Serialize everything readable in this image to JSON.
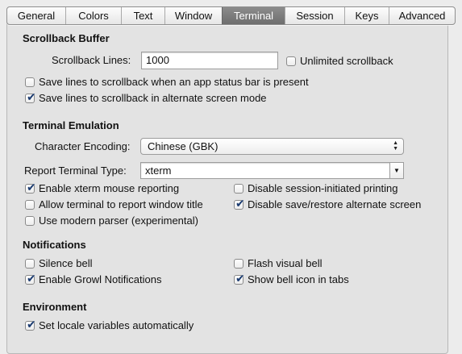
{
  "tabs": [
    {
      "label": "General"
    },
    {
      "label": "Colors"
    },
    {
      "label": "Text"
    },
    {
      "label": "Window"
    },
    {
      "label": "Terminal",
      "active": true
    },
    {
      "label": "Session"
    },
    {
      "label": "Keys"
    },
    {
      "label": "Advanced"
    }
  ],
  "scrollback": {
    "heading": "Scrollback Buffer",
    "lines_label": "Scrollback Lines:",
    "lines_value": "1000",
    "unlimited_label": "Unlimited scrollback",
    "unlimited_checked": false,
    "status_bar_label": "Save lines to scrollback when an app status bar is present",
    "status_bar_checked": false,
    "alt_screen_label": "Save lines to scrollback in alternate screen mode",
    "alt_screen_checked": true
  },
  "emulation": {
    "heading": "Terminal Emulation",
    "encoding_label": "Character Encoding:",
    "encoding_value": "Chinese (GBK)",
    "report_type_label": "Report Terminal Type:",
    "report_type_value": "xterm",
    "xterm_mouse_label": "Enable xterm mouse reporting",
    "xterm_mouse_checked": true,
    "disable_printing_label": "Disable session-initiated printing",
    "disable_printing_checked": false,
    "window_title_label": "Allow terminal to report window title",
    "window_title_checked": false,
    "disable_save_restore_label": "Disable save/restore alternate screen",
    "disable_save_restore_checked": true,
    "modern_parser_label": "Use modern parser (experimental)",
    "modern_parser_checked": false
  },
  "notifications": {
    "heading": "Notifications",
    "silence_bell_label": "Silence bell",
    "silence_bell_checked": false,
    "flash_bell_label": "Flash visual bell",
    "flash_bell_checked": false,
    "growl_label": "Enable Growl Notifications",
    "growl_checked": true,
    "bell_icon_label": "Show bell icon in tabs",
    "bell_icon_checked": true
  },
  "environment": {
    "heading": "Environment",
    "locale_label": "Set locale variables automatically",
    "locale_checked": true
  }
}
